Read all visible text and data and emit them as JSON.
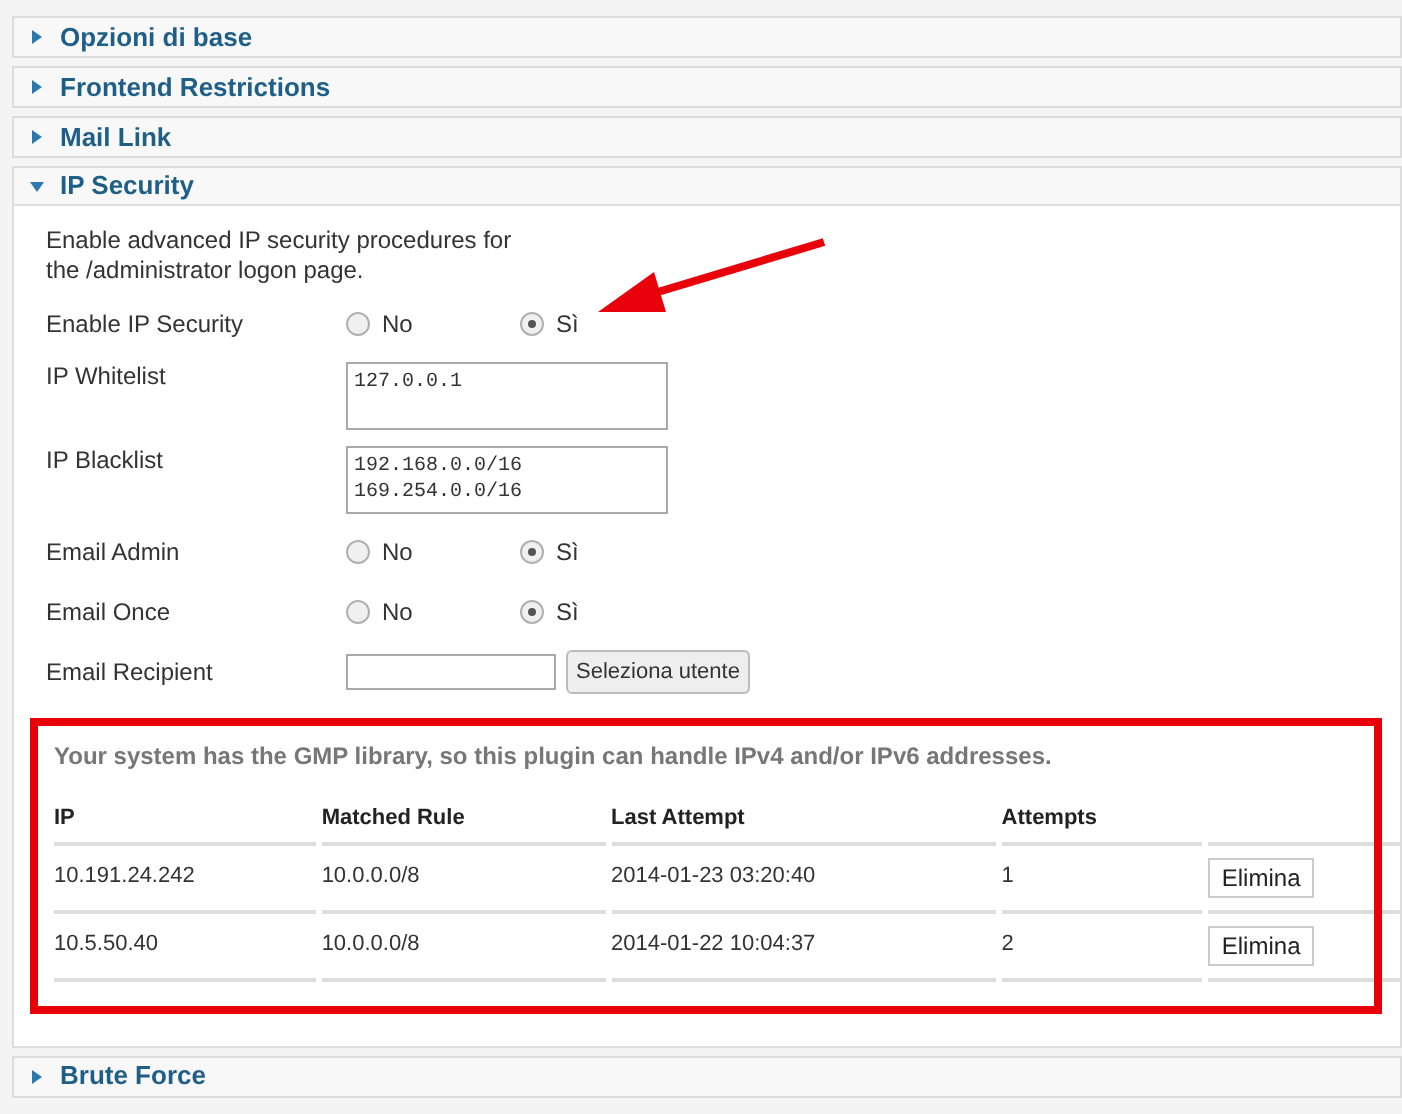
{
  "panels": [
    {
      "title": "Opzioni di base",
      "expanded": false
    },
    {
      "title": "Frontend Restrictions",
      "expanded": false
    },
    {
      "title": "Mail Link",
      "expanded": false
    },
    {
      "title": "IP Security",
      "expanded": true,
      "description": "Enable advanced IP security procedures for the /administrator logon page.",
      "fields": [
        {
          "kind": "radio",
          "label": "Enable IP Security",
          "options": [
            {
              "label": "No",
              "selected": false
            },
            {
              "label": "Sì",
              "selected": true
            }
          ]
        },
        {
          "kind": "textarea",
          "label": "IP Whitelist",
          "value": "127.0.0.1"
        },
        {
          "kind": "textarea",
          "label": "IP Blacklist",
          "value": "192.168.0.0/16\n169.254.0.0/16"
        },
        {
          "kind": "radio",
          "label": "Email Admin",
          "options": [
            {
              "label": "No",
              "selected": false
            },
            {
              "label": "Sì",
              "selected": true
            }
          ]
        },
        {
          "kind": "radio",
          "label": "Email Once",
          "options": [
            {
              "label": "No",
              "selected": false
            },
            {
              "label": "Sì",
              "selected": true
            }
          ]
        },
        {
          "kind": "picker",
          "label": "Email Recipient",
          "button": "Seleziona utente"
        }
      ],
      "notice": "Your system has the GMP library, so this plugin can handle IPv4 and/or IPv6 addresses.",
      "table": {
        "columns": [
          "IP",
          "Matched Rule",
          "Last Attempt",
          "Attempts"
        ],
        "rows": [
          {
            "cells": [
              "10.191.24.242",
              "10.0.0.0/8",
              "2014-01-23 03:20:40",
              "1"
            ],
            "action": "Elimina"
          },
          {
            "cells": [
              "10.5.50.40",
              "10.0.0.0/8",
              "2014-01-22 10:04:37",
              "2"
            ],
            "action": "Elimina"
          }
        ]
      }
    },
    {
      "title": "Brute Force",
      "expanded": false
    }
  ]
}
